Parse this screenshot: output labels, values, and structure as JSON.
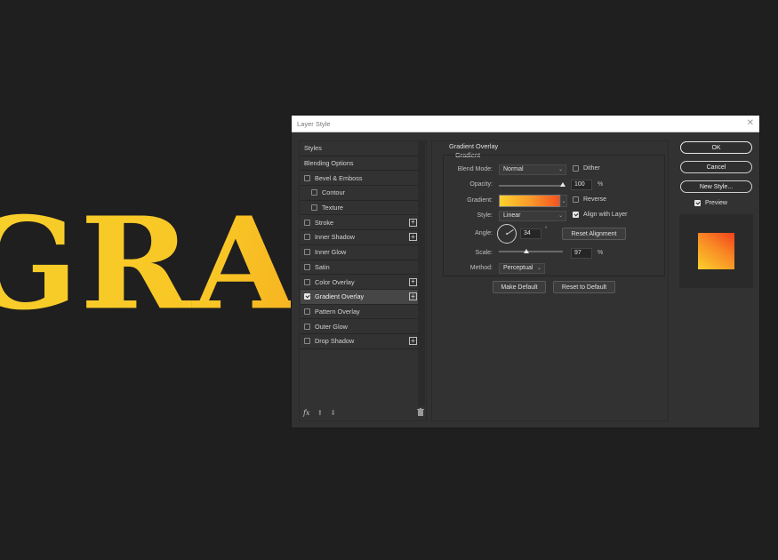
{
  "canvas": {
    "text": "GRAD"
  },
  "dialog": {
    "title": "Layer Style",
    "styles_list": {
      "items": [
        {
          "label": "Styles",
          "type": "header"
        },
        {
          "label": "Blending Options",
          "type": "header"
        },
        {
          "label": "Bevel & Emboss",
          "checked": false,
          "plus": false,
          "indent": false
        },
        {
          "label": "Contour",
          "checked": false,
          "plus": false,
          "indent": true
        },
        {
          "label": "Texture",
          "checked": false,
          "plus": false,
          "indent": true
        },
        {
          "label": "Stroke",
          "checked": false,
          "plus": true,
          "indent": false
        },
        {
          "label": "Inner Shadow",
          "checked": false,
          "plus": true,
          "indent": false
        },
        {
          "label": "Inner Glow",
          "checked": false,
          "plus": false,
          "indent": false
        },
        {
          "label": "Satin",
          "checked": false,
          "plus": false,
          "indent": false
        },
        {
          "label": "Color Overlay",
          "checked": false,
          "plus": true,
          "indent": false
        },
        {
          "label": "Gradient Overlay",
          "checked": true,
          "plus": true,
          "indent": false,
          "selected": true
        },
        {
          "label": "Pattern Overlay",
          "checked": false,
          "plus": false,
          "indent": false
        },
        {
          "label": "Outer Glow",
          "checked": false,
          "plus": false,
          "indent": false
        },
        {
          "label": "Drop Shadow",
          "checked": false,
          "plus": true,
          "indent": false
        }
      ],
      "footer": {
        "fx": "fx",
        "up": "⬆",
        "down": "⬇",
        "trash": "🗑"
      }
    },
    "gradient_overlay": {
      "section_title": "Gradient Overlay",
      "group_title": "Gradient",
      "blend_mode_label": "Blend Mode:",
      "blend_mode_value": "Normal",
      "dither_label": "Dither",
      "dither_checked": false,
      "opacity_label": "Opacity:",
      "opacity_value": "100",
      "opacity_fraction": 1.0,
      "opacity_unit": "%",
      "gradient_label": "Gradient:",
      "reverse_label": "Reverse",
      "reverse_checked": false,
      "style_label": "Style:",
      "style_value": "Linear",
      "align_label": "Align with Layer",
      "align_checked": true,
      "angle_label": "Angle:",
      "angle_value": "34",
      "angle_unit": "°",
      "reset_alignment_label": "Reset Alignment",
      "scale_label": "Scale:",
      "scale_value": "97",
      "scale_fraction": 0.43,
      "scale_unit": "%",
      "method_label": "Method:",
      "method_value": "Perceptual",
      "make_default_label": "Make Default",
      "reset_default_label": "Reset to Default"
    },
    "right": {
      "ok_label": "OK",
      "cancel_label": "Cancel",
      "new_style_label": "New Style...",
      "preview_label": "Preview",
      "preview_checked": true
    }
  }
}
